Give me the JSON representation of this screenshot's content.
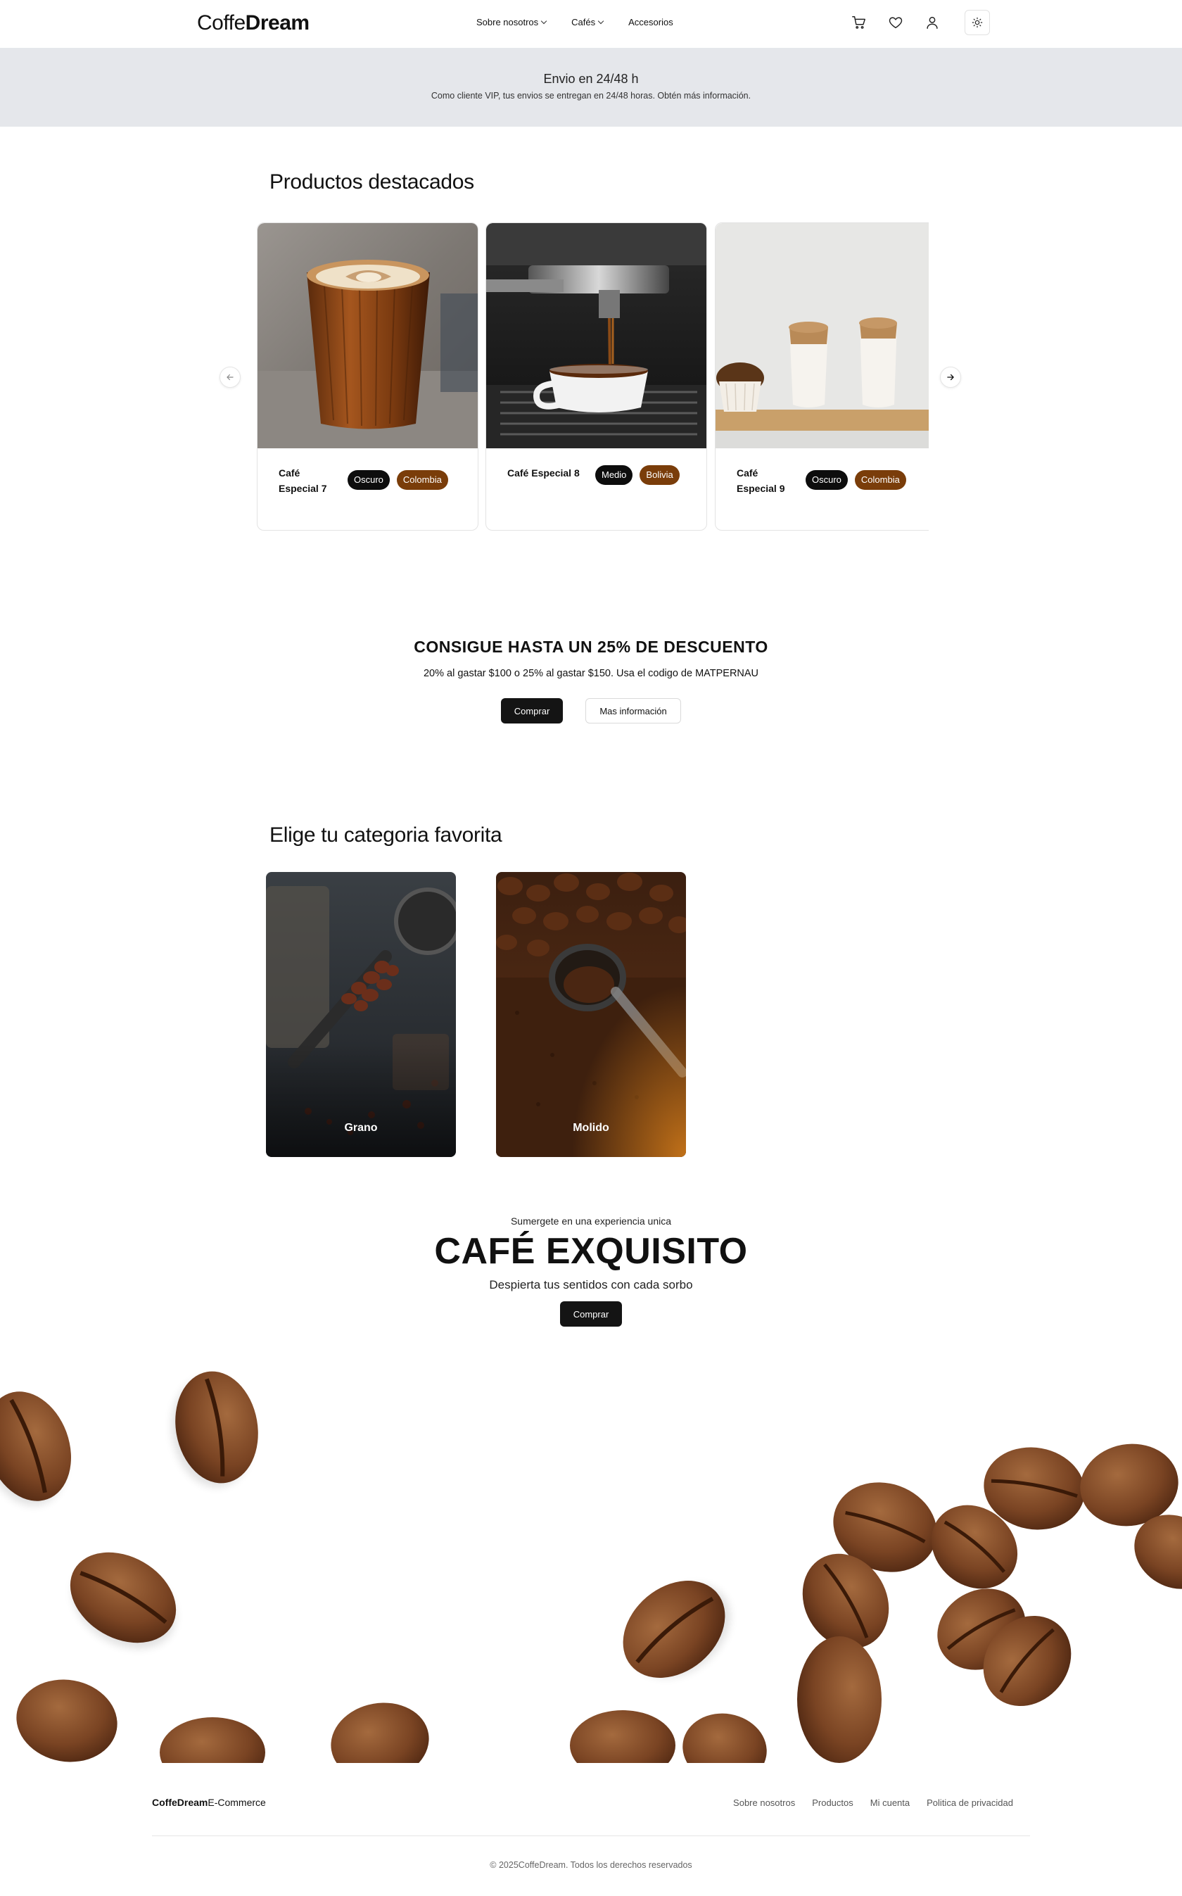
{
  "header": {
    "logo_light": "Coffe",
    "logo_bold": "Dream",
    "nav": [
      "Sobre nosotros",
      "Cafés",
      "Accesorios"
    ],
    "icons": [
      "cart-icon",
      "heart-icon",
      "user-icon",
      "sun-icon"
    ]
  },
  "banner": {
    "title": "Envio en 24/48 h",
    "subtitle": "Como cliente VIP, tus envios se entregan en 24/48 horas. Obtén más información."
  },
  "featured": {
    "title": "Productos destacados",
    "products": [
      {
        "name_line1": "Café",
        "name_line2": "Especial 7",
        "roast": "Oscuro",
        "origin": "Colombia"
      },
      {
        "name_line1": "Café Especial 8",
        "name_line2": "",
        "roast": "Medio",
        "origin": "Bolivia"
      },
      {
        "name_line1": "Café",
        "name_line2": "Especial 9",
        "roast": "Oscuro",
        "origin": "Colombia"
      }
    ]
  },
  "promo": {
    "title": "CONSIGUE HASTA UN 25% DE DESCUENTO",
    "subtitle": "20% al gastar $100 o 25% al gastar $150. Usa el codigo de MATPERNAU",
    "buy_label": "Comprar",
    "info_label": "Mas información"
  },
  "categories": {
    "title": "Elige tu categoria favorita",
    "items": [
      "Grano",
      "Molido"
    ]
  },
  "hero": {
    "kicker": "Sumergete en una experiencia unica",
    "title": "CAFÉ EXQUISITO",
    "subtitle": "Despierta tus sentidos con cada sorbo",
    "buy_label": "Comprar"
  },
  "footer": {
    "brand_bold": "CoffeDream",
    "brand_light": "E-Commerce",
    "links": [
      "Sobre nosotros",
      "Productos",
      "Mi cuenta",
      "Politica de privacidad"
    ],
    "copyright": "© 2025CoffeDream. Todos los derechos reservados"
  },
  "colors": {
    "banner_bg": "#e5e7eb",
    "tag_dark": "#0d0d0d",
    "tag_brown": "#7a3d0a",
    "button_dark": "#141414"
  }
}
